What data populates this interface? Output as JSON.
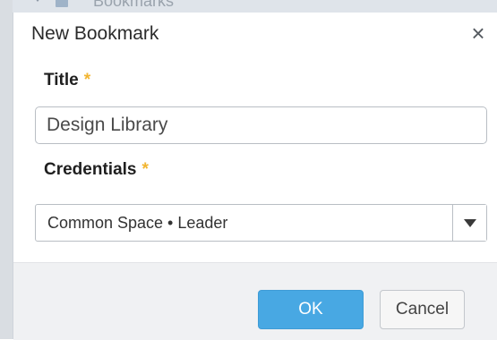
{
  "background": {
    "label": "Bookmarks"
  },
  "dialog": {
    "title": "New Bookmark",
    "close_symbol": "×"
  },
  "form": {
    "title_field": {
      "label": "Title",
      "required_marker": "*",
      "value": "Design Library"
    },
    "credentials_field": {
      "label": "Credentials",
      "required_marker": "*",
      "selected": "Common Space • Leader"
    }
  },
  "buttons": {
    "ok": "OK",
    "cancel": "Cancel"
  },
  "colors": {
    "ok_button": "#48a8e3",
    "required_star": "#f2b531"
  },
  "icons": {
    "close": "close-icon",
    "dropdown": "chevron-down-icon"
  }
}
